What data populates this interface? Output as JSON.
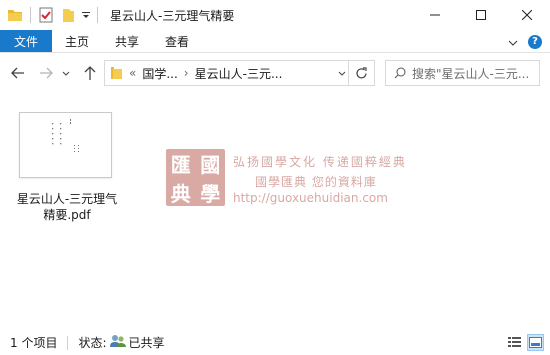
{
  "window": {
    "title": "星云山人-三元理气精要"
  },
  "ribbon": {
    "tabs": [
      "文件",
      "主页",
      "共享",
      "查看"
    ]
  },
  "address": {
    "crumbs": [
      "国学...",
      "星云山人-三元..."
    ]
  },
  "search": {
    "placeholder": "搜索\"星云山人-三元..."
  },
  "files": [
    {
      "name": "星云山人-三元理气精要.pdf"
    }
  ],
  "watermark": {
    "seal_chars": [
      "匯",
      "國",
      "典",
      "學"
    ],
    "line1": "弘扬國學文化 传递國粹經典",
    "line2": "國學匯典 您的資料庫",
    "line3": "http://guoxuehuidian.com"
  },
  "status": {
    "count": "1 个项目",
    "share_label": "状态:",
    "share_value": "已共享"
  },
  "colors": {
    "accent": "#1979ca",
    "watermark": "#d8a8a3",
    "folder": "#e8b931"
  }
}
